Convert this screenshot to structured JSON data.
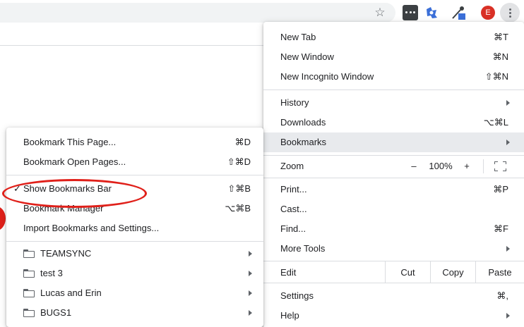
{
  "toolbar": {
    "avatar_letter": "E",
    "icons": [
      "star-icon",
      "extension-dots-icon",
      "extension-puzzle-icon",
      "eyedropper-icon",
      "more-vert-icon"
    ]
  },
  "main_menu": {
    "items": {
      "new_tab": {
        "label": "New Tab",
        "shortcut": "⌘T"
      },
      "new_window": {
        "label": "New Window",
        "shortcut": "⌘N"
      },
      "new_incognito": {
        "label": "New Incognito Window",
        "shortcut": "⇧⌘N"
      },
      "history": {
        "label": "History"
      },
      "downloads": {
        "label": "Downloads",
        "shortcut": "⌥⌘L"
      },
      "bookmarks": {
        "label": "Bookmarks"
      },
      "print": {
        "label": "Print...",
        "shortcut": "⌘P"
      },
      "cast": {
        "label": "Cast..."
      },
      "find": {
        "label": "Find...",
        "shortcut": "⌘F"
      },
      "more_tools": {
        "label": "More Tools"
      },
      "settings": {
        "label": "Settings",
        "shortcut": "⌘,"
      },
      "help": {
        "label": "Help"
      }
    },
    "zoom": {
      "label": "Zoom",
      "minus": "–",
      "value": "100%",
      "plus": "+"
    },
    "edit": {
      "label": "Edit",
      "cut": "Cut",
      "copy": "Copy",
      "paste": "Paste"
    }
  },
  "bookmarks_menu": {
    "bookmark_page": {
      "label": "Bookmark This Page...",
      "shortcut": "⌘D"
    },
    "bookmark_open_pages": {
      "label": "Bookmark Open Pages...",
      "shortcut": "⇧⌘D"
    },
    "show_bar": {
      "label": "Show Bookmarks Bar",
      "shortcut": "⇧⌘B",
      "check": "✓"
    },
    "manager": {
      "label": "Bookmark Manager",
      "shortcut": "⌥⌘B"
    },
    "import": {
      "label": "Import Bookmarks and Settings..."
    },
    "folders": [
      "TEAMSYNC",
      "test 3",
      "Lucas and Erin",
      "BUGS1"
    ]
  },
  "colors": {
    "highlight": "#e0201a",
    "hover": "#e8eaed",
    "avatar": "#d93025"
  }
}
